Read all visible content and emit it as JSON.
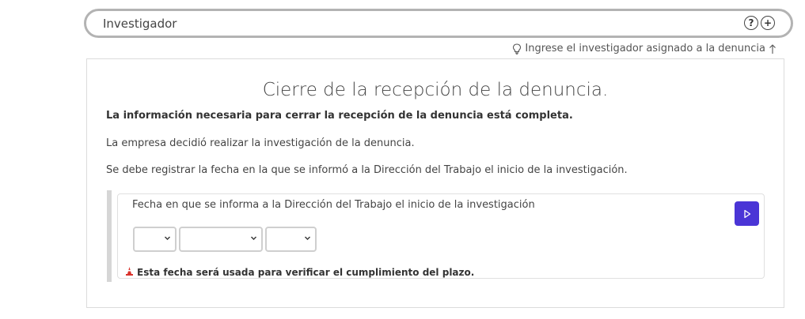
{
  "investigator": {
    "value": "Investigador",
    "help_icon_glyph": "?",
    "add_icon_glyph": "+",
    "hint": "Ingrese el investigador asignado a la denuncia"
  },
  "card": {
    "title": "Cierre de la recepción de la denuncia.",
    "complete_notice": "La información necesaria para cerrar la recepción de la denuncia está completa.",
    "decision_text": "La empresa decidió realizar la investigación de la denuncia.",
    "register_text": "Se debe registrar la fecha en la que se informó a la Dirección del Trabajo el inicio de la investigación."
  },
  "date_question": {
    "label": "Fecha en que se informa a la Dirección del Trabajo el inicio de la investigación",
    "day_value": "",
    "month_value": "",
    "year_value": "",
    "warning": "Esta fecha será usada para verificar el cumplimiento del plazo."
  },
  "colors": {
    "accent": "#4a35d6",
    "warning_icon": "#d9322b"
  }
}
